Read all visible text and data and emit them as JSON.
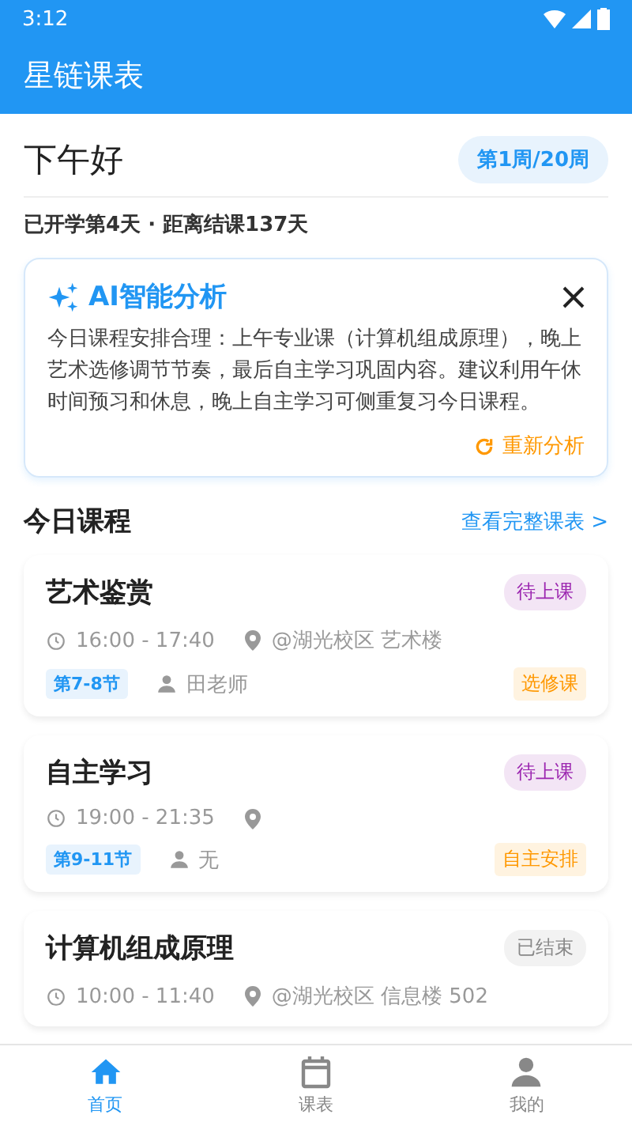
{
  "status_bar": {
    "time": "3:12"
  },
  "app_bar": {
    "title": "星链课表"
  },
  "greeting": {
    "text": "下午好",
    "week_badge": "第1周/20周",
    "subtitle": "已开学第4天 · 距离结课137天"
  },
  "ai_card": {
    "title": "AI智能分析",
    "body": "今日课程安排合理：上午专业课（计算机组成原理），晚上艺术选修调节节奏，最后自主学习巩固内容。建议利用午休时间预习和休息，晚上自主学习可侧重复习今日课程。",
    "action": "重新分析"
  },
  "today": {
    "title": "今日课程",
    "link": "查看完整课表 >"
  },
  "courses": [
    {
      "name": "艺术鉴赏",
      "status": {
        "kind": "upcoming",
        "label": "待上课"
      },
      "time": "16:00 - 17:40",
      "location": "@湖光校区 艺术楼",
      "periods": "第7-8节",
      "teacher": "田老师",
      "tag": "选修课"
    },
    {
      "name": "自主学习",
      "status": {
        "kind": "upcoming",
        "label": "待上课"
      },
      "time": "19:00 - 21:35",
      "periods": "第9-11节",
      "teacher": "无",
      "tag": "自主安排"
    },
    {
      "name": "计算机组成原理",
      "status": {
        "kind": "ended",
        "label": "已结束"
      },
      "time": "10:00 - 11:40",
      "location": "@湖光校区 信息楼 502"
    }
  ],
  "nav": [
    {
      "label": "首页",
      "kind": "home",
      "selected": true
    },
    {
      "label": "课表",
      "kind": "calendar",
      "selected": false
    },
    {
      "label": "我的",
      "kind": "person",
      "selected": false
    }
  ]
}
